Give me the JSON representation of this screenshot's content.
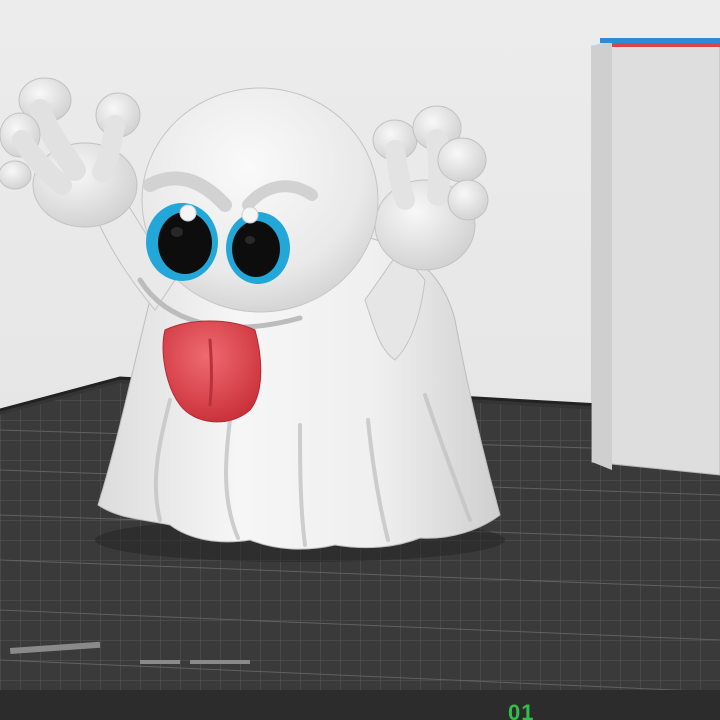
{
  "scene": {
    "description_title": "",
    "bed_corner_label": "01",
    "colors": {
      "background": "#e8e8e8",
      "bed_surface": "#3a3a3a",
      "bed_grid": "#575757",
      "bed_edge": "#1e1e1e",
      "model_body": "#f2f2f2",
      "model_shadow": "#c9c9c9",
      "iris": "#22a7d8",
      "pupil": "#0d0d0d",
      "tongue": "#e5404a",
      "wipe_tower_top_blue": "#2d8ad6",
      "wipe_tower_top_red": "#d8454a",
      "corner_label_green": "#2fbf4a"
    }
  }
}
